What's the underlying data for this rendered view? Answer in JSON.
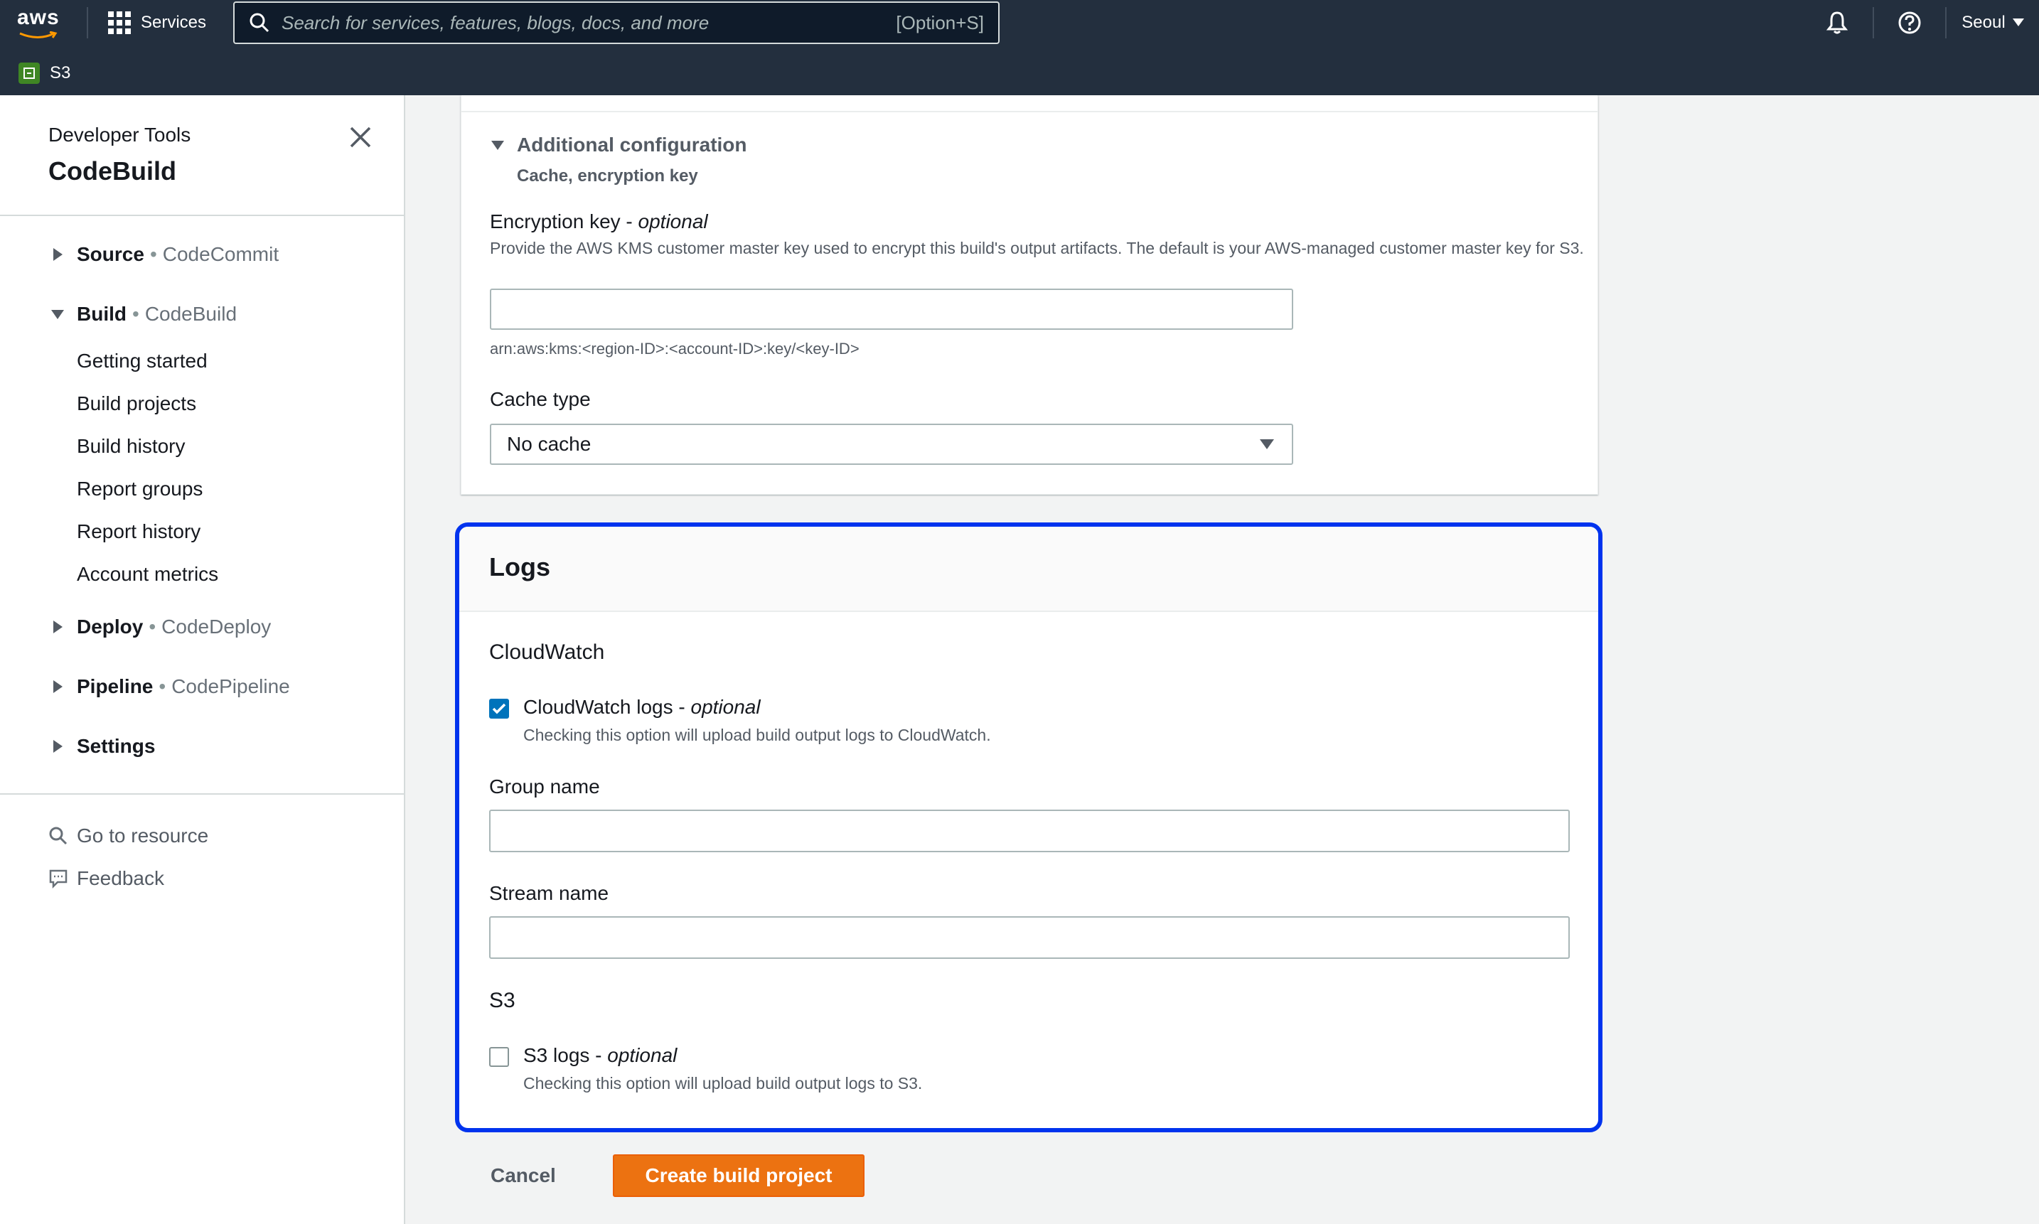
{
  "topbar": {
    "logo_text": "aws",
    "services_label": "Services",
    "search_placeholder": "Search for services, features, blogs, docs, and more",
    "search_shortcut": "[Option+S]",
    "region": "Seoul",
    "favorite_service": "S3",
    "colors": {
      "bg": "#232f3e",
      "s3_badge": "#3f8624"
    }
  },
  "sidebar": {
    "overline": "Developer Tools",
    "title": "CodeBuild",
    "sections": [
      {
        "label": "Source",
        "service": "CodeCommit",
        "expanded": false
      },
      {
        "label": "Build",
        "service": "CodeBuild",
        "expanded": true
      },
      {
        "label": "Deploy",
        "service": "CodeDeploy",
        "expanded": false
      },
      {
        "label": "Pipeline",
        "service": "CodePipeline",
        "expanded": false
      },
      {
        "label": "Settings",
        "service": "",
        "expanded": false
      }
    ],
    "build_items": [
      "Getting started",
      "Build projects",
      "Build history",
      "Report groups",
      "Report history",
      "Account metrics"
    ],
    "utilities": [
      "Go to resource",
      "Feedback"
    ]
  },
  "additional_config": {
    "title": "Additional configuration",
    "subtitle": "Cache, encryption key",
    "encryption_label": "Encryption key - ",
    "encryption_optional": "optional",
    "encryption_desc": "Provide the AWS KMS customer master key used to encrypt this build's output artifacts. The default is your AWS-managed customer master key for S3.",
    "encryption_value": "",
    "encryption_hint": "arn:aws:kms:<region-ID>:<account-ID>:key/<key-ID>",
    "cache_label": "Cache type",
    "cache_value": "No cache"
  },
  "logs": {
    "title": "Logs",
    "cloudwatch_heading": "CloudWatch",
    "cloudwatch_checkbox_label": "CloudWatch logs - ",
    "cloudwatch_optional": "optional",
    "cloudwatch_checked": true,
    "cloudwatch_desc": "Checking this option will upload build output logs to CloudWatch.",
    "group_name_label": "Group name",
    "group_name_value": "",
    "stream_name_label": "Stream name",
    "stream_name_value": "",
    "s3_heading": "S3",
    "s3_checkbox_label": "S3 logs - ",
    "s3_optional": "optional",
    "s3_checked": false,
    "s3_desc": "Checking this option will upload build output logs to S3.",
    "highlight_color": "#0033ee"
  },
  "actions": {
    "cancel_label": "Cancel",
    "create_label": "Create build project",
    "create_color": "#ec7211"
  }
}
